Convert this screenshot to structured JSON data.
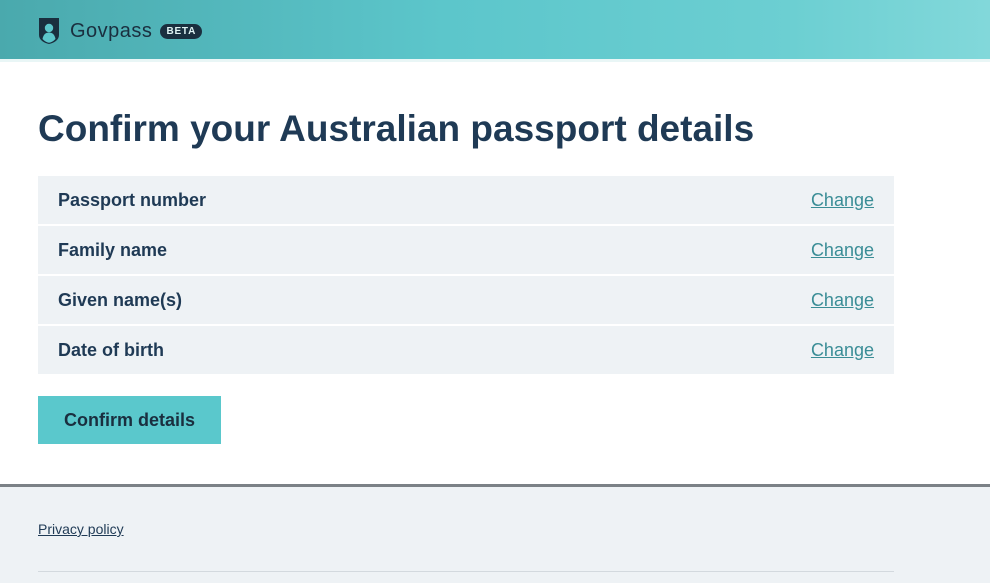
{
  "header": {
    "brand": "Govpass",
    "badge": "BETA"
  },
  "main": {
    "title": "Confirm your Australian passport details",
    "rows": [
      {
        "label": "Passport number",
        "action": "Change"
      },
      {
        "label": "Family name",
        "action": "Change"
      },
      {
        "label": "Given name(s)",
        "action": "Change"
      },
      {
        "label": "Date of birth",
        "action": "Change"
      }
    ],
    "confirm_label": "Confirm details"
  },
  "footer": {
    "privacy_label": "Privacy policy"
  },
  "colors": {
    "accent": "#5ac8cc",
    "heading": "#1f3a55",
    "link": "#3a8d96",
    "row_bg": "#eef2f5"
  },
  "icons": {
    "logo": "shield-person-icon"
  }
}
